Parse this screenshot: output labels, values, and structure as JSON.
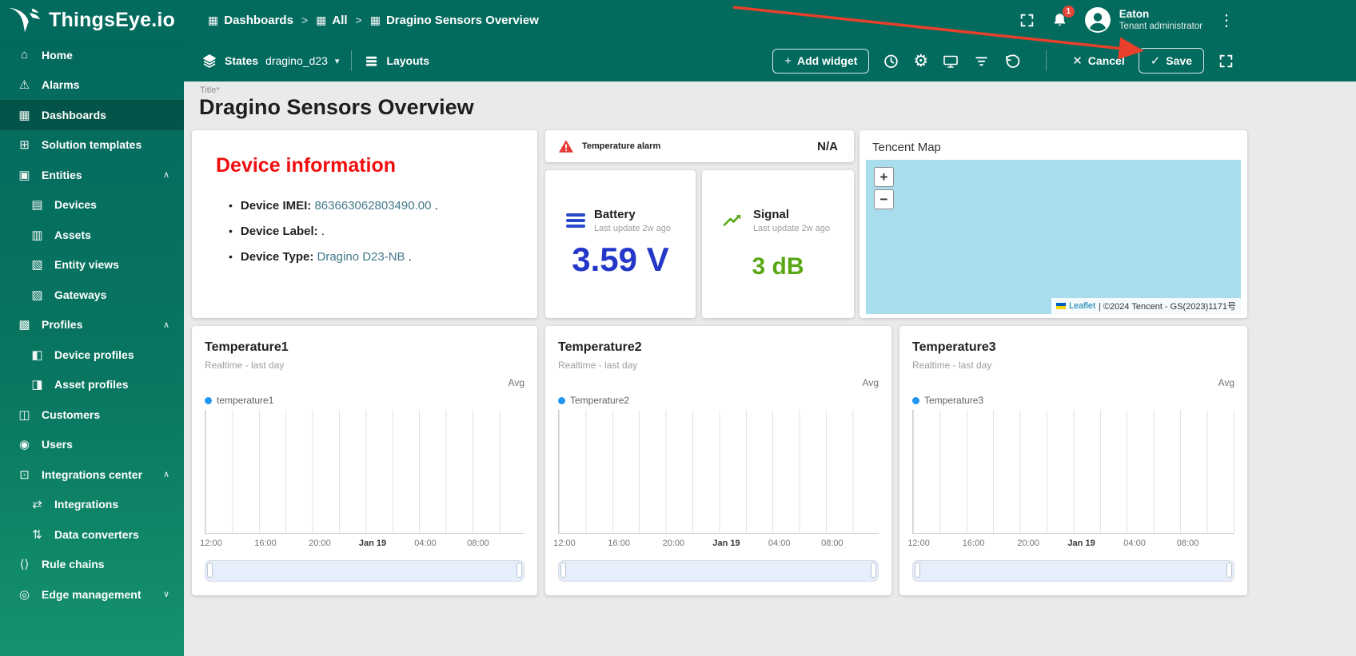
{
  "colors": {
    "primary_teal": "#036A5E",
    "sidebar_active": "rgba(0,0,0,0.22)",
    "accent_red_heading": "#F20D0D",
    "battery_blue": "#2437C9",
    "signal_green": "#58A813",
    "legend_blue": "#2196F3",
    "map_water": "#A9DCEC",
    "alarm_red": "#E53935",
    "annotation_arrow_red": "#E8402A",
    "link_teal": "#43788A"
  },
  "topbar": {
    "logo_text": "ThingsEye.io",
    "separator": ">",
    "breadcrumb": [
      {
        "label": "Dashboards",
        "glyph": "▦"
      },
      {
        "label": "All",
        "glyph": "▦"
      },
      {
        "label": "Dragino Sensors Overview",
        "glyph": "▦"
      }
    ],
    "notification_count": "1",
    "user_name": "Eaton",
    "user_role": "Tenant administrator",
    "kebab_glyph": "⋮"
  },
  "toolbar": {
    "states_label": "States",
    "states_value": "dragino_d23",
    "dropdown_glyph": "▾",
    "layouts_label": "Layouts",
    "plus_glyph": "+",
    "add_widget_label": "Add widget",
    "gear_glyph": "⚙",
    "cancel_glyph": "✕",
    "cancel_label": "Cancel",
    "save_glyph": "✓",
    "save_label": "Save"
  },
  "sidebar": {
    "items": [
      {
        "label": "Home",
        "glyph": "⌂"
      },
      {
        "label": "Alarms",
        "glyph": "⚠"
      },
      {
        "label": "Dashboards",
        "glyph": "▦"
      },
      {
        "label": "Solution templates",
        "glyph": "⊞"
      },
      {
        "label": "Entities",
        "glyph": "▣",
        "chevron": "∧"
      },
      {
        "label": "Devices",
        "glyph": "▤"
      },
      {
        "label": "Assets",
        "glyph": "▥"
      },
      {
        "label": "Entity views",
        "glyph": "▧"
      },
      {
        "label": "Gateways",
        "glyph": "▨"
      },
      {
        "label": "Profiles",
        "glyph": "▩",
        "chevron": "∧"
      },
      {
        "label": "Device profiles",
        "glyph": "◧"
      },
      {
        "label": "Asset profiles",
        "glyph": "◨"
      },
      {
        "label": "Customers",
        "glyph": "◫"
      },
      {
        "label": "Users",
        "glyph": "◉"
      },
      {
        "label": "Integrations center",
        "glyph": "⊡",
        "chevron": "∧"
      },
      {
        "label": "Integrations",
        "glyph": "⇄"
      },
      {
        "label": "Data converters",
        "glyph": "⇅"
      },
      {
        "label": "Rule chains",
        "glyph": "⟨⟩"
      },
      {
        "label": "Edge management",
        "glyph": "◎",
        "chevron": "∨"
      }
    ]
  },
  "main": {
    "title_label": "Title*",
    "title_value": "Dragino Sensors Overview",
    "device_info": {
      "heading": "Device information",
      "rows": [
        {
          "label": "Device IMEI:",
          "value": "863663062803490.00",
          "suffix": " ."
        },
        {
          "label": "Device Label:",
          "value": "",
          "suffix": " ."
        },
        {
          "label": "Device Type:",
          "value": "Dragino D23-NB",
          "suffix": " ."
        }
      ]
    },
    "alarm": {
      "label": "Temperature alarm",
      "value": "N/A"
    },
    "battery": {
      "title": "Battery",
      "subtitle": "Last update 2w ago",
      "value": "3.59 V"
    },
    "signal": {
      "title": "Signal",
      "subtitle": "Last update 2w ago",
      "value": "3 dB"
    },
    "map": {
      "title": "Tencent Map",
      "zoom_in": "+",
      "zoom_out": "−",
      "attribution_link": "Leaflet",
      "attribution_text": "| ©2024 Tencent - GS(2023)1171号"
    }
  },
  "charts": [
    {
      "type": "line",
      "title": "Temperature1",
      "subtitle": "Realtime - last day",
      "agg_label": "Avg",
      "legend": "temperature1",
      "xticks": [
        "12:00",
        "16:00",
        "20:00",
        "Jan 19",
        "04:00",
        "08:00"
      ],
      "series_values": []
    },
    {
      "type": "line",
      "title": "Temperature2",
      "subtitle": "Realtime - last day",
      "agg_label": "Avg",
      "legend": "Temperature2",
      "xticks": [
        "12:00",
        "16:00",
        "20:00",
        "Jan 19",
        "04:00",
        "08:00"
      ],
      "series_values": []
    },
    {
      "type": "line",
      "title": "Temperature3",
      "subtitle": "Realtime - last day",
      "agg_label": "Avg",
      "legend": "Temperature3",
      "xticks": [
        "12:00",
        "16:00",
        "20:00",
        "Jan 19",
        "04:00",
        "08:00"
      ],
      "series_values": []
    }
  ]
}
